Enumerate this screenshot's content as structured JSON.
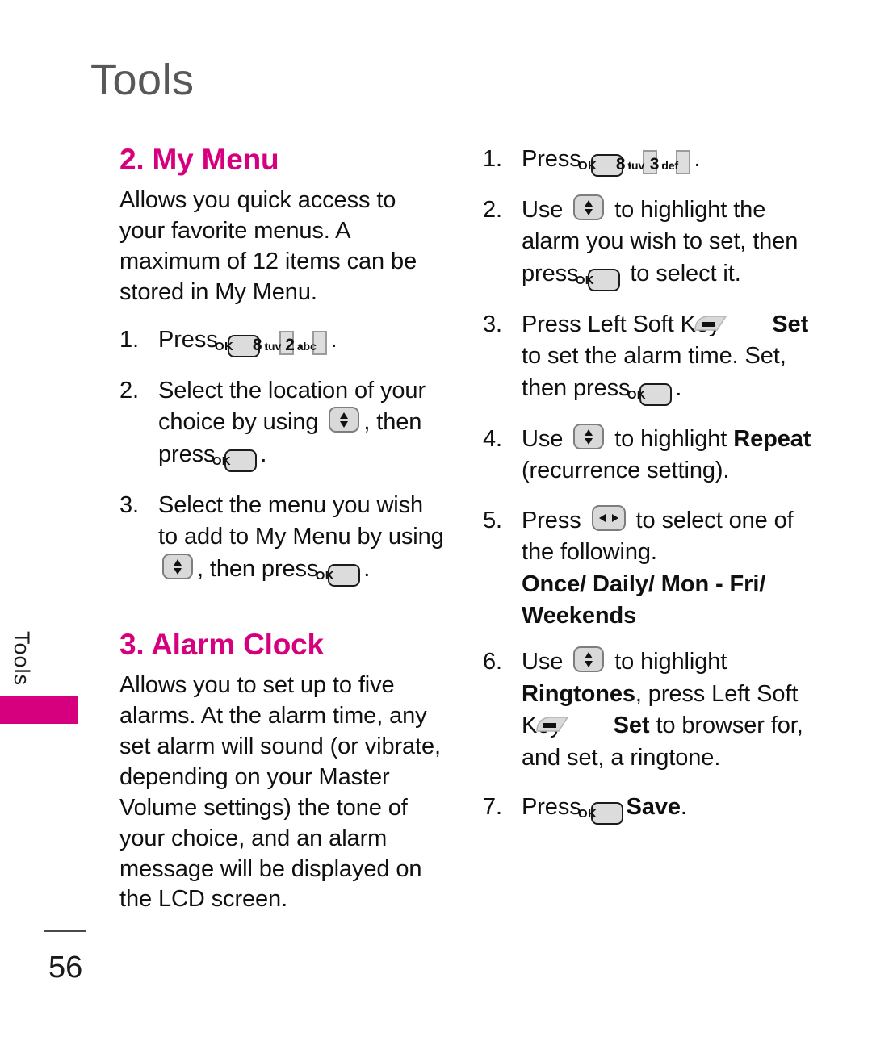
{
  "page": {
    "chapter_title": "Tools",
    "side_tab_label": "Tools",
    "page_number": "56",
    "accent_color": "#D6007F",
    "chapter_title_color": "#58585A"
  },
  "left_column": {
    "section_1": {
      "heading": "2. My Menu",
      "intro": "Allows you quick access to your favorite menus. A maximum of 12 items can be stored in My Menu.",
      "steps": [
        {
          "num": "1.",
          "parts": [
            {
              "type": "text",
              "value": "Press "
            },
            {
              "type": "key-ok",
              "value": "OK"
            },
            {
              "type": "text",
              "value": ", "
            },
            {
              "type": "key-num",
              "digit": "8",
              "letters": "tuv"
            },
            {
              "type": "text",
              "value": ", "
            },
            {
              "type": "key-num",
              "digit": "2",
              "letters": "abc"
            },
            {
              "type": "text",
              "value": "."
            }
          ]
        },
        {
          "num": "2.",
          "parts": [
            {
              "type": "text",
              "value": "Select the location of your choice by using "
            },
            {
              "type": "key-nav-v",
              "value": "up-down-navigation-key"
            },
            {
              "type": "text",
              "value": ", then press "
            },
            {
              "type": "key-ok",
              "value": "OK"
            },
            {
              "type": "text",
              "value": "."
            }
          ]
        },
        {
          "num": "3.",
          "parts": [
            {
              "type": "text",
              "value": "Select the menu you wish to add to My Menu by using "
            },
            {
              "type": "key-nav-v",
              "value": "up-down-navigation-key"
            },
            {
              "type": "text",
              "value": ", then press "
            },
            {
              "type": "key-ok",
              "value": "OK"
            },
            {
              "type": "text",
              "value": "."
            }
          ]
        }
      ]
    },
    "section_2": {
      "heading": "3. Alarm Clock",
      "intro": "Allows you to set up to five alarms. At the alarm time, any set alarm will sound (or vibrate, depending on your Master Volume settings) the tone of your choice, and an alarm message will be displayed on the LCD screen."
    }
  },
  "right_column": {
    "steps": [
      {
        "num": "1.",
        "parts": [
          {
            "type": "text",
            "value": "Press "
          },
          {
            "type": "key-ok",
            "value": "OK"
          },
          {
            "type": "text",
            "value": ", "
          },
          {
            "type": "key-num",
            "digit": "8",
            "letters": "tuv"
          },
          {
            "type": "text",
            "value": ", "
          },
          {
            "type": "key-num",
            "digit": "3",
            "letters": "def"
          },
          {
            "type": "text",
            "value": "."
          }
        ]
      },
      {
        "num": "2.",
        "parts": [
          {
            "type": "text",
            "value": "Use "
          },
          {
            "type": "key-nav-v",
            "value": "up-down-navigation-key"
          },
          {
            "type": "text",
            "value": " to highlight the alarm you wish to set, then press "
          },
          {
            "type": "key-ok",
            "value": "OK"
          },
          {
            "type": "text",
            "value": " to select it."
          }
        ]
      },
      {
        "num": "3.",
        "parts": [
          {
            "type": "text",
            "value": "Press Left Soft Key "
          },
          {
            "type": "key-soft",
            "value": "left-soft-key"
          },
          {
            "type": "bold",
            "value": "Set"
          },
          {
            "type": "text",
            "value": " to set the alarm time. Set, then press "
          },
          {
            "type": "key-ok",
            "value": "OK"
          },
          {
            "type": "text",
            "value": "."
          }
        ]
      },
      {
        "num": "4.",
        "parts": [
          {
            "type": "text",
            "value": "Use "
          },
          {
            "type": "key-nav-v",
            "value": "up-down-navigation-key"
          },
          {
            "type": "text",
            "value": " to highlight "
          },
          {
            "type": "bold",
            "value": "Repeat"
          },
          {
            "type": "text",
            "value": " (recurrence setting)."
          }
        ]
      },
      {
        "num": "5.",
        "parts": [
          {
            "type": "text",
            "value": "Press "
          },
          {
            "type": "key-nav-h",
            "value": "left-right-navigation-key"
          },
          {
            "type": "text",
            "value": " to select one of the following."
          },
          {
            "type": "bold-block",
            "value": "Once/ Daily/ Mon - Fri/ Weekends"
          }
        ]
      },
      {
        "num": "6.",
        "parts": [
          {
            "type": "text",
            "value": "Use "
          },
          {
            "type": "key-nav-v",
            "value": "up-down-navigation-key"
          },
          {
            "type": "text",
            "value": " to highlight "
          },
          {
            "type": "bold",
            "value": "Ringtones"
          },
          {
            "type": "text",
            "value": ", press Left Soft Key "
          },
          {
            "type": "key-soft",
            "value": "left-soft-key"
          },
          {
            "type": "bold",
            "value": "Set"
          },
          {
            "type": "text",
            "value": " to browser for, and set, a ringtone."
          }
        ]
      },
      {
        "num": "7.",
        "parts": [
          {
            "type": "text",
            "value": "Press "
          },
          {
            "type": "key-ok",
            "value": "OK"
          },
          {
            "type": "bold",
            "value": "Save"
          },
          {
            "type": "text",
            "value": "."
          }
        ]
      }
    ],
    "options_line_1": "Once/ Daily/ Mon - Fri/",
    "options_line_2": "Weekends"
  }
}
